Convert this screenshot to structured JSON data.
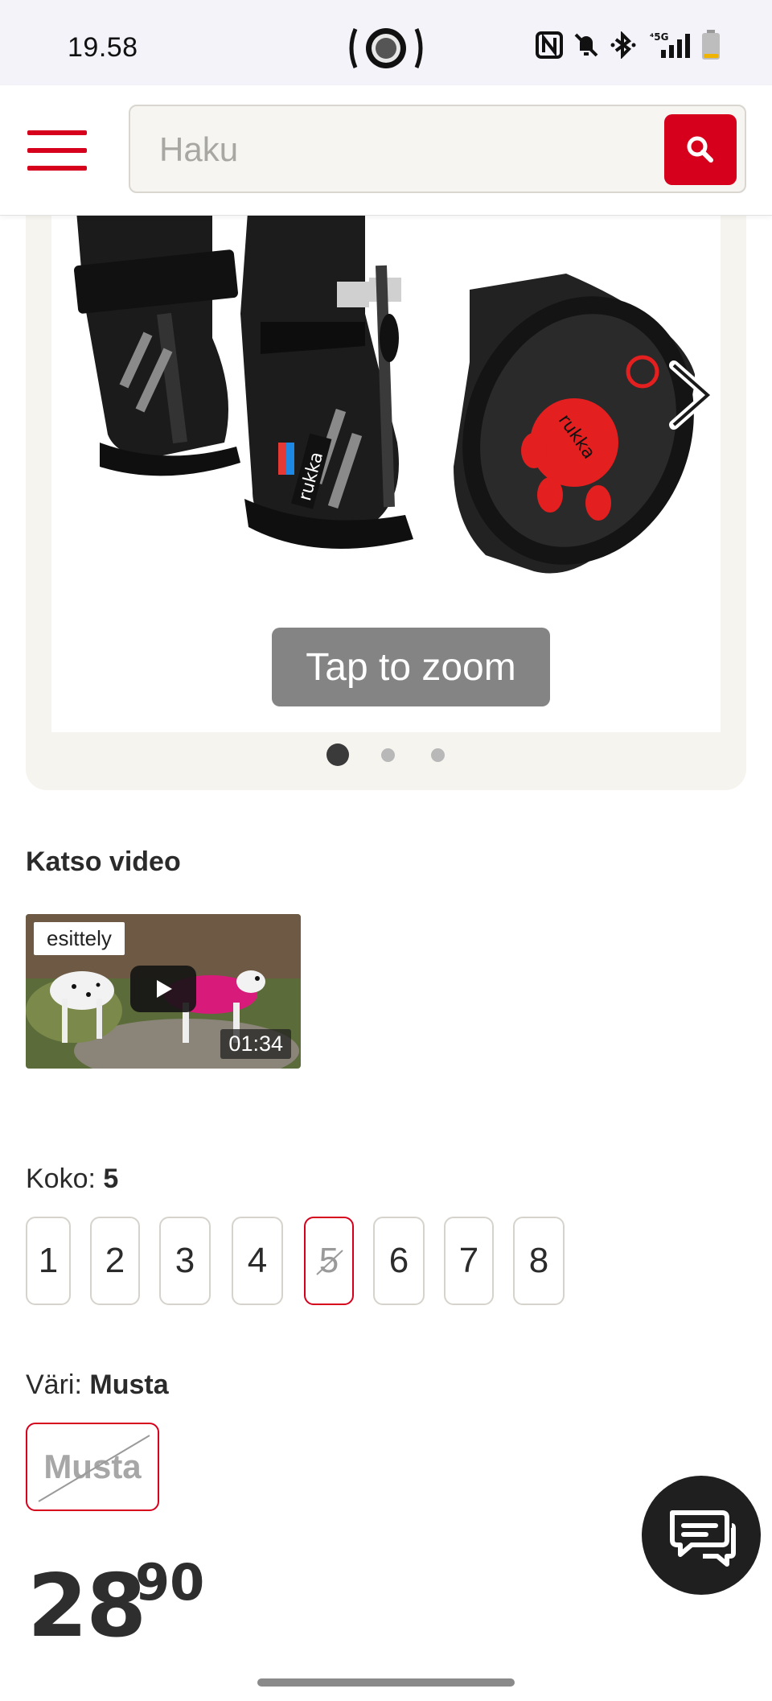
{
  "status_bar": {
    "time": "19.58",
    "icons": [
      "nfc-icon",
      "mute-icon",
      "bluetooth-icon",
      "5g-signal-icon",
      "battery-icon"
    ]
  },
  "header": {
    "search_placeholder": "Haku",
    "accent_color": "#d6001c"
  },
  "gallery": {
    "zoom_hint": "Tap to zoom",
    "slide_count": 3,
    "active_slide": 1,
    "product_image_text": [
      "rukka",
      "rukka"
    ]
  },
  "video": {
    "heading": "Katso video",
    "tag": "esittely",
    "duration": "01:34"
  },
  "size": {
    "label": "Koko:",
    "selected": "5",
    "options": [
      "1",
      "2",
      "3",
      "4",
      "5",
      "6",
      "7",
      "8"
    ],
    "unavailable": [
      "5"
    ]
  },
  "color": {
    "label": "Väri:",
    "selected": "Musta",
    "options": [
      "Musta"
    ]
  },
  "price": {
    "main": "28",
    "cents": "90"
  },
  "chat": {
    "icon": "chat-icon"
  }
}
